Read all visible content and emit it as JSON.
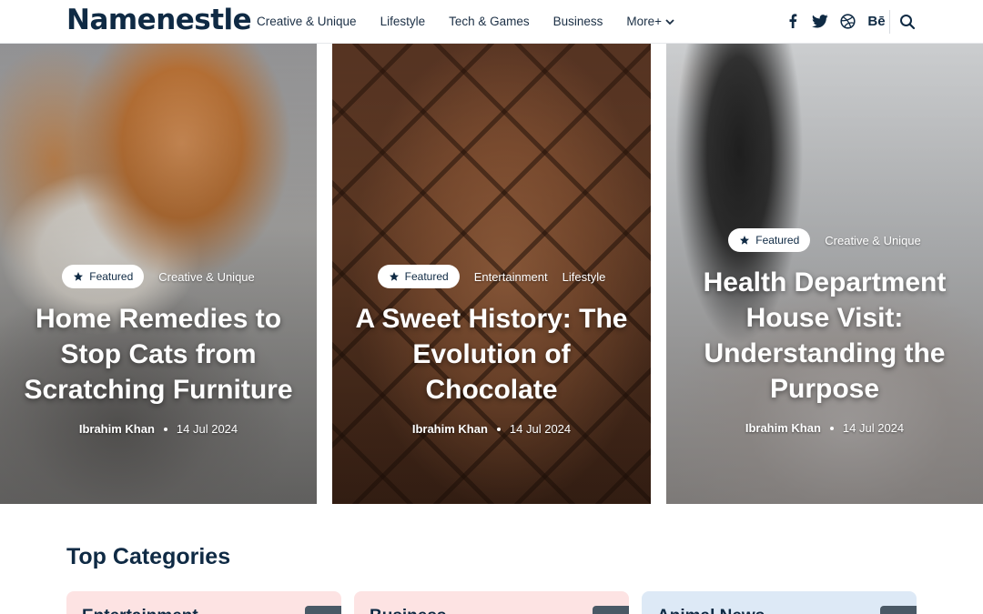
{
  "site": {
    "logo": "Namenestle"
  },
  "nav": {
    "items": [
      "Creative & Unique",
      "Lifestyle",
      "Tech & Games",
      "Business"
    ],
    "more_label": "More+"
  },
  "social": {
    "icons": [
      "facebook-icon",
      "twitter-icon",
      "dribbble-icon",
      "behance-icon"
    ],
    "behance_label": "Bē"
  },
  "hero": {
    "cards": [
      {
        "badge": "Featured",
        "tags": [
          "Creative & Unique"
        ],
        "title": "Home Remedies to Stop Cats from Scratching Furniture",
        "author": "Ibrahim Khan",
        "date": "14 Jul 2024"
      },
      {
        "badge": "Featured",
        "tags": [
          "Entertainment",
          "Lifestyle"
        ],
        "title": "A Sweet History: The Evolution of Chocolate",
        "author": "Ibrahim Khan",
        "date": "14 Jul 2024"
      },
      {
        "badge": "Featured",
        "tags": [
          "Creative & Unique"
        ],
        "title": "Health Department House Visit: Understanding the Purpose",
        "author": "Ibrahim Khan",
        "date": "14 Jul 2024"
      }
    ]
  },
  "categories": {
    "title": "Top Categories",
    "items": [
      {
        "name": "Entertainment",
        "color": "#fde3e3"
      },
      {
        "name": "Business",
        "color": "#fde3e3"
      },
      {
        "name": "Animal News",
        "color": "#dde9f6"
      }
    ]
  },
  "colors": {
    "brand": "#0f2a44",
    "pill_bg": "#ffffff"
  }
}
